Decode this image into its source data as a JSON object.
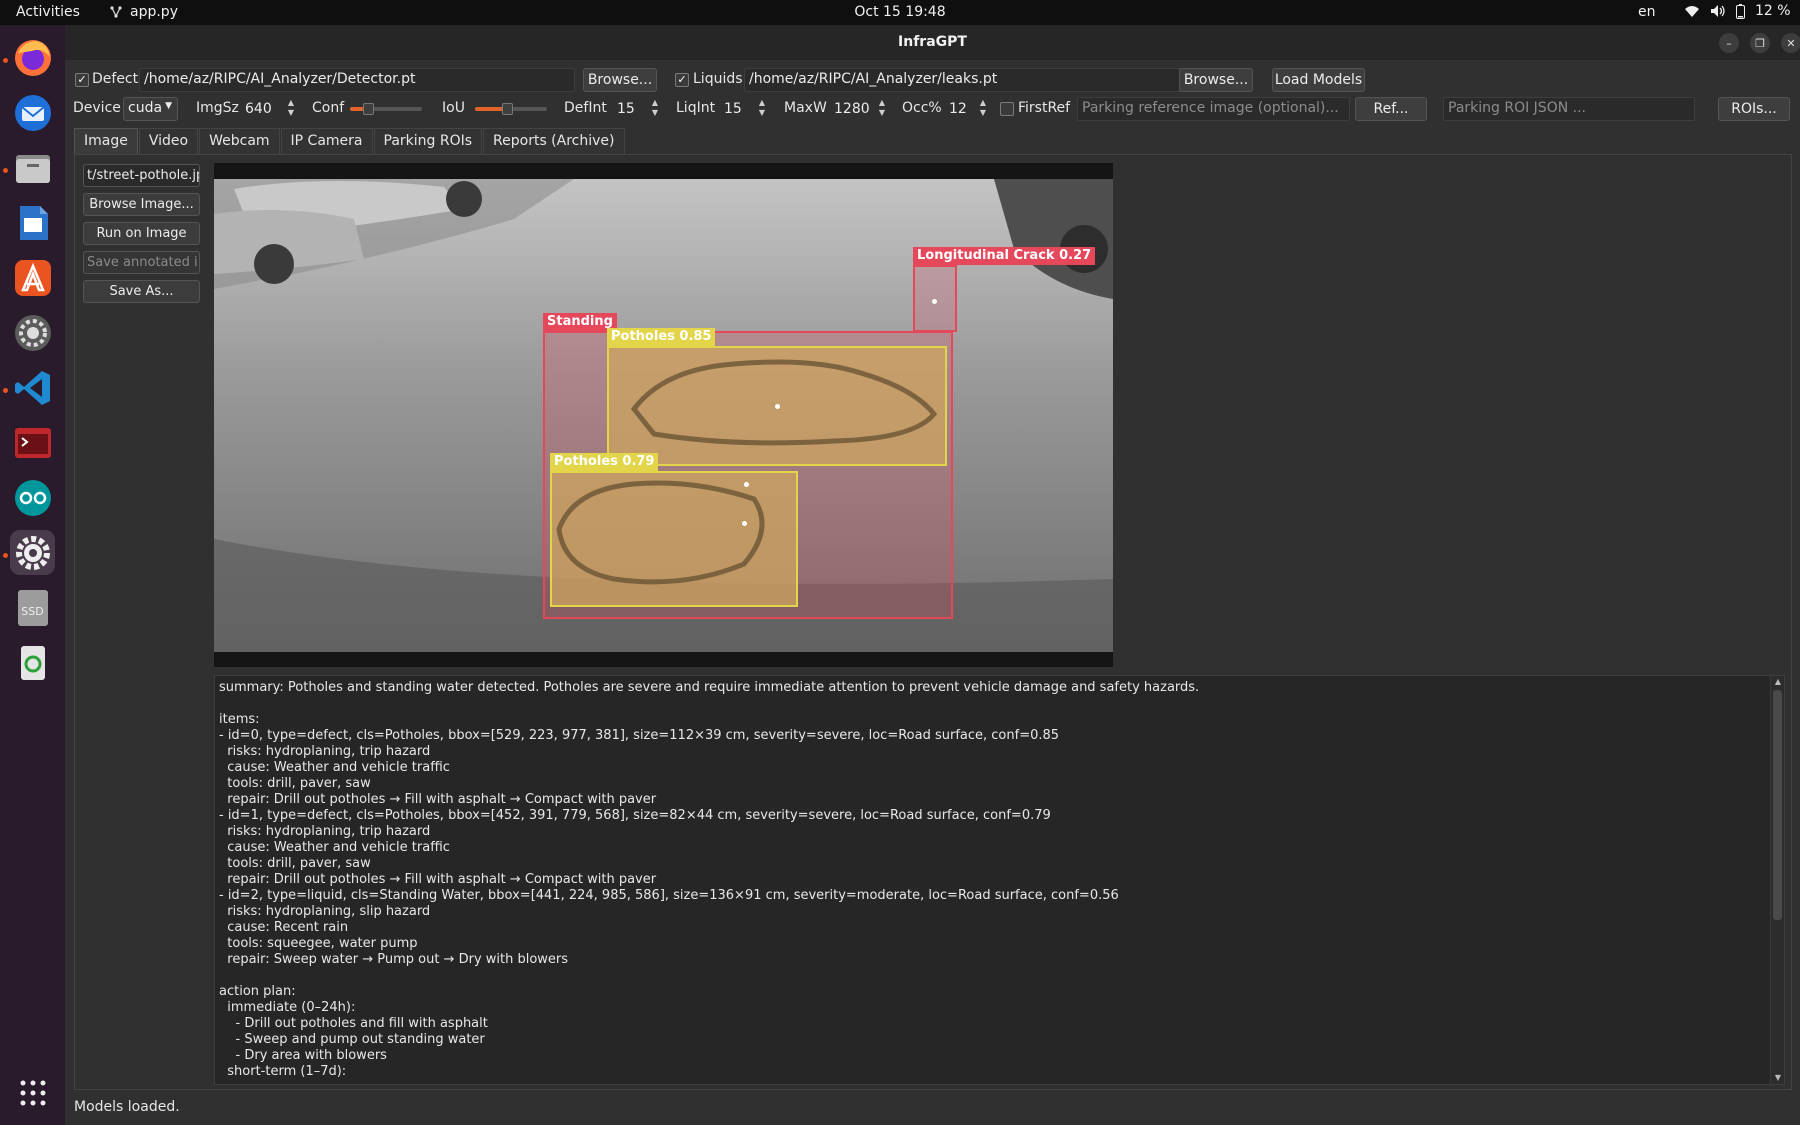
{
  "topbar": {
    "activities": "Activities",
    "app_name": "app.py",
    "clock": "Oct 15  19:48",
    "language": "en",
    "battery": "12 %"
  },
  "dock": {
    "items": [
      "firefox-icon",
      "thunderbird-icon",
      "files-icon",
      "writer-icon",
      "app-center-icon",
      "settings-wheel-icon",
      "vscode-icon",
      "terminal-app-icon",
      "arduino-icon",
      "settings-icon",
      "ssd-drive-icon",
      "trash-icon",
      "show-apps-icon"
    ],
    "ssd_label": "SSD"
  },
  "window": {
    "title": "InfraGPT"
  },
  "toolbar": {
    "defects_label": "Defects",
    "defects_path": "/home/az/RIPC/AI_Analyzer/Detector.pt",
    "browse1": "Browse...",
    "liquids_label": "Liquids",
    "liquids_path": "/home/az/RIPC/AI_Analyzer/leaks.pt",
    "browse2": "Browse...",
    "load_models": "Load Models"
  },
  "settings": {
    "device_label": "Device",
    "device_value": "cuda",
    "imgsz_label": "ImgSz",
    "imgsz_value": "640",
    "conf_label": "Conf",
    "conf_level": 0.25,
    "iou_label": "IoU",
    "iou_level": 0.45,
    "defint_label": "DefInt",
    "defint_value": "15",
    "liqint_label": "LiqInt",
    "liqint_value": "15",
    "maxw_label": "MaxW",
    "maxw_value": "1280",
    "occ_label": "Occ%",
    "occ_value": "12",
    "firstref_label": "FirstRef",
    "parking_ref_placeholder": "Parking reference image (optional)...",
    "ref_button": "Ref...",
    "parking_roi_placeholder": "Parking ROI JSON ...",
    "rois_button": "ROIs..."
  },
  "tabs": [
    "Image",
    "Video",
    "Webcam",
    "IP Camera",
    "Parking ROIs",
    "Reports (Archive)"
  ],
  "sidebar": {
    "file": "t/street-pothole.jpg",
    "browse_image": "Browse Image...",
    "run": "Run on Image",
    "save_annotated": "Save annotated i...",
    "save_as": "Save As..."
  },
  "detections": [
    {
      "label": "Longitudinal Crack 0.27",
      "color": "#e5485a"
    },
    {
      "label": "Standing",
      "color": "#e5485a"
    },
    {
      "label": "Potholes 0.85",
      "color": "#e2d54a"
    },
    {
      "label": "Potholes 0.79",
      "color": "#e2d54a"
    }
  ],
  "report": {
    "lines": [
      "summary: Potholes and standing water detected. Potholes are severe and require immediate attention to prevent vehicle damage and safety hazards.",
      "",
      "items:",
      "- id=0, type=defect, cls=Potholes, bbox=[529, 223, 977, 381], size=112×39 cm, severity=severe, loc=Road surface, conf=0.85",
      "  risks: hydroplaning, trip hazard",
      "  cause: Weather and vehicle traffic",
      "  tools: drill, paver, saw",
      "  repair: Drill out potholes → Fill with asphalt → Compact with paver",
      "- id=1, type=defect, cls=Potholes, bbox=[452, 391, 779, 568], size=82×44 cm, severity=severe, loc=Road surface, conf=0.79",
      "  risks: hydroplaning, trip hazard",
      "  cause: Weather and vehicle traffic",
      "  tools: drill, paver, saw",
      "  repair: Drill out potholes → Fill with asphalt → Compact with paver",
      "- id=2, type=liquid, cls=Standing Water, bbox=[441, 224, 985, 586], size=136×91 cm, severity=moderate, loc=Road surface, conf=0.56",
      "  risks: hydroplaning, slip hazard",
      "  cause: Recent rain",
      "  tools: squeegee, water pump",
      "  repair: Sweep water → Pump out → Dry with blowers",
      "",
      "action plan:",
      "  immediate (0–24h):",
      "    - Drill out potholes and fill with asphalt",
      "    - Sweep and pump out standing water",
      "    - Dry area with blowers",
      "  short-term (1–7d):"
    ]
  },
  "status": "Models loaded."
}
